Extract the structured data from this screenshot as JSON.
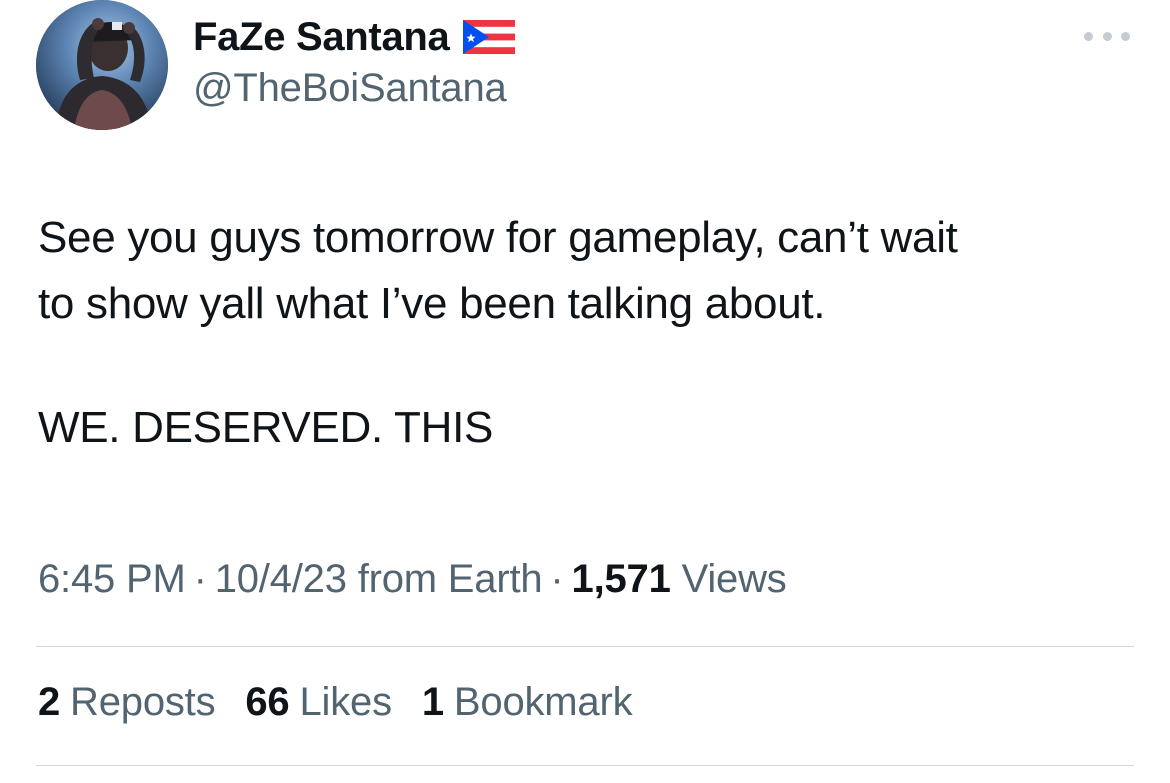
{
  "author": {
    "display_name": "FaZe Santana",
    "flag_icon": "puerto-rico-flag-icon",
    "handle": "@TheBoiSantana"
  },
  "more_icon": "more-horizontal-icon",
  "tweet": {
    "line1": "See you guys tomorrow for gameplay, can’t wait",
    "line2": "to show yall what I’ve been talking about.",
    "line3": "WE. DESERVED. THIS"
  },
  "meta": {
    "time": "6:45 PM",
    "date": "10/4/23",
    "source": "from Earth",
    "views_count": "1,571",
    "views_label": "Views"
  },
  "stats": {
    "reposts_count": "2",
    "reposts_label": "Reposts",
    "likes_count": "66",
    "likes_label": "Likes",
    "bookmarks_count": "1",
    "bookmarks_label": "Bookmark"
  },
  "colors": {
    "primary_text": "#0f1419",
    "secondary_text": "#536471",
    "divider": "#cfd9de"
  }
}
